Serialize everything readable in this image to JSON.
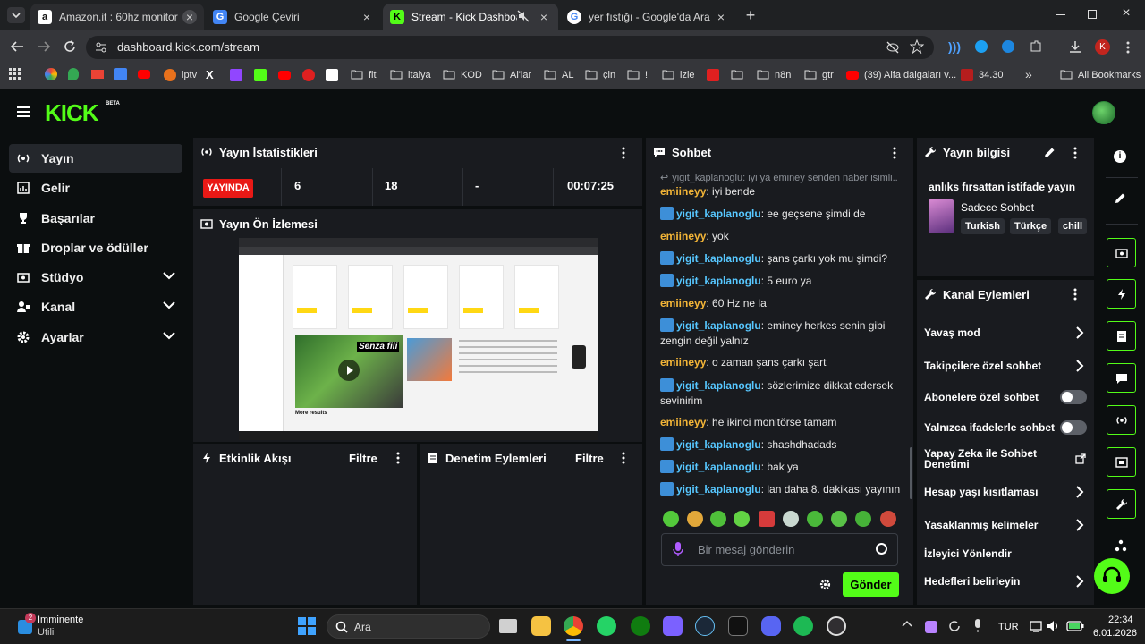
{
  "browser": {
    "tabs": [
      {
        "title": "Amazon.it : 60hz monitor",
        "favicon": "a"
      },
      {
        "title": "Google Çeviri",
        "favicon": "G"
      },
      {
        "title": "Stream - Kick Dashboard",
        "favicon": "K"
      },
      {
        "title": "yer fıstığı - Google'da Ara",
        "favicon": "G"
      }
    ],
    "url": "dashboard.kick.com/stream",
    "profile_initial": "K",
    "bookmarks": [
      "iptv",
      "fit",
      "italya",
      "KOD",
      "Al'lar",
      "AL",
      "çin",
      "!",
      "izle",
      "n8n",
      "gtr",
      "(39) Alfa dalgaları v...",
      "34.30",
      "All Bookmarks"
    ]
  },
  "kick": {
    "logo_badge": "BETA",
    "sidebar": {
      "items": [
        {
          "label": "Yayın"
        },
        {
          "label": "Gelir"
        },
        {
          "label": "Başarılar"
        },
        {
          "label": "Droplar ve ödüller"
        },
        {
          "label": "Stüdyo"
        },
        {
          "label": "Kanal"
        },
        {
          "label": "Ayarlar"
        }
      ]
    },
    "stats": {
      "title": "Yayın İstatistikleri",
      "live_badge": "YAYINDA",
      "viewers": "6",
      "followers": "18",
      "other": "-",
      "duration": "00:07:25"
    },
    "preview": {
      "title": "Yayın Ön İzlemesi",
      "thumb_text": "Senza fili",
      "thumb_footer": "More results"
    },
    "activity": {
      "title": "Etkinlik Akışı",
      "filter": "Filtre"
    },
    "moderation": {
      "title": "Denetim Eylemleri",
      "filter": "Filtre"
    },
    "chat": {
      "title": "Sohbet",
      "reply_preview": "yigit_kaplanoglu: iyi ya eminey senden naber isimli...",
      "messages": [
        {
          "user": "emiineyy",
          "text": "iyi bende"
        },
        {
          "user": "yigit_kaplanoglu",
          "text": "ee geçsene şimdi de"
        },
        {
          "user": "emiineyy",
          "text": "yok"
        },
        {
          "user": "yigit_kaplanoglu",
          "text": "şans çarkı yok mu şimdi?"
        },
        {
          "user": "yigit_kaplanoglu",
          "text": "5 euro ya"
        },
        {
          "user": "emiineyy",
          "text": "60 Hz ne la"
        },
        {
          "user": "yigit_kaplanoglu",
          "text": "eminey herkes senin gibi zengin değil yalnız"
        },
        {
          "user": "emiineyy",
          "text": "o zaman şans çarkı şart"
        },
        {
          "user": "yigit_kaplanoglu",
          "text": "sözlerimize dikkat edersek sevinirim"
        },
        {
          "user": "emiineyy",
          "text": "he ikinci monitörse tamam"
        },
        {
          "user": "yigit_kaplanoglu",
          "text": "shashdhadads"
        },
        {
          "user": "yigit_kaplanoglu",
          "text": "bak ya"
        },
        {
          "user": "yigit_kaplanoglu",
          "text": "lan daha 8. dakikası yayının"
        }
      ],
      "input_placeholder": "Bir mesaj gönderin",
      "send_label": "Gönder"
    },
    "stream_info": {
      "title": "Yayın bilgisi",
      "stream_title": "anlıks fırsattan istifade yayın",
      "category": "Sadece Sohbet",
      "tags": [
        "Turkish",
        "Türkçe",
        "chill"
      ]
    },
    "channel_actions": {
      "title": "Kanal Eylemleri",
      "items": [
        {
          "label": "Yavaş mod",
          "control": "arrow"
        },
        {
          "label": "Takipçilere özel sohbet",
          "control": "arrow"
        },
        {
          "label": "Abonelere özel sohbet",
          "control": "toggle"
        },
        {
          "label": "Yalnızca ifadelerle sohbet",
          "control": "toggle"
        },
        {
          "label": "Yapay Zeka ile Sohbet Denetimi",
          "control": "external"
        },
        {
          "label": "Hesap yaşı kısıtlaması",
          "control": "arrow"
        },
        {
          "label": "Yasaklanmış kelimeler",
          "control": "arrow"
        },
        {
          "label": "İzleyici Yönlendir",
          "control": "none"
        },
        {
          "label": "Hedefleri belirleyin",
          "control": "arrow"
        }
      ]
    },
    "colors": {
      "accent": "#53fc18",
      "live": "#e91916",
      "panel": "#191b1f"
    }
  },
  "taskbar": {
    "weather_title": "Imminente",
    "weather_sub": "Utili",
    "weather_badge": "2",
    "search_placeholder": "Ara",
    "lang": "TUR",
    "time": "22:34",
    "date": "6.01.2026"
  }
}
